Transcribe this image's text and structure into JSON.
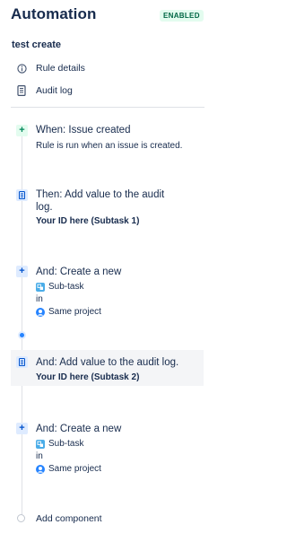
{
  "header": {
    "title": "Automation",
    "status_badge": "ENABLED"
  },
  "rule": {
    "name": "test create"
  },
  "nav": [
    {
      "label": "Rule details",
      "icon": "info-icon"
    },
    {
      "label": "Audit log",
      "icon": "document-icon"
    }
  ],
  "components": {
    "trigger": {
      "icon": "+",
      "title": "When: Issue created",
      "description": "Rule is run when an issue is created."
    },
    "action1": {
      "title_line1": "Then: Add value to the audit",
      "title_line2": "log.",
      "value": "Your ID here (Subtask 1)"
    },
    "action2": {
      "icon": "+",
      "title": "And: Create a new",
      "issue_type": "Sub-task",
      "connector": "in",
      "project": "Same project"
    },
    "action3": {
      "title": "And: Add value to the audit log.",
      "value": "Your ID here (Subtask 2)"
    },
    "action4": {
      "icon": "+",
      "title": "And: Create a new",
      "issue_type": "Sub-task",
      "connector": "in",
      "project": "Same project"
    }
  },
  "add_component": {
    "label": "Add component"
  },
  "colors": {
    "trigger_bg": "#e3fcef",
    "trigger_fg": "#00875a",
    "action_bg": "#deebff",
    "action_fg": "#0052cc",
    "branch_dot": "#2684ff",
    "badge_bg": "#e3fcef",
    "badge_fg": "#006644"
  }
}
